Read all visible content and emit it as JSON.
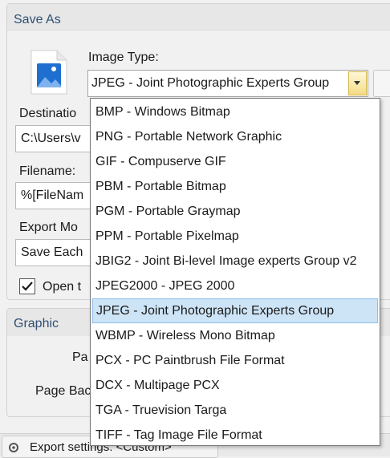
{
  "save_as": {
    "title": "Save As",
    "image_type_label": "Image Type:",
    "image_type_value": "JPEG - Joint Photographic Experts Group",
    "destination_label": "Destinatio",
    "destination_value": "C:\\Users\\v",
    "filename_label": "Filename:",
    "filename_value": "%[FileNam",
    "export_mode_label": "Export Mo",
    "export_mode_value": "Save Each",
    "open_label": "Open t",
    "open_checked": true
  },
  "graphic": {
    "title": "Graphic",
    "pa_label": "Pa",
    "page_bac_label": "Page Bac"
  },
  "footer": {
    "export_settings": "Export settings:  <Custom>"
  },
  "dropdown": {
    "options": [
      "BMP - Windows Bitmap",
      "PNG - Portable Network Graphic",
      "GIF - Compuserve GIF",
      "PBM - Portable Bitmap",
      "PGM - Portable Graymap",
      "PPM - Portable Pixelmap",
      "JBIG2 - Joint Bi-level Image experts Group v2",
      "JPEG2000 - JPEG 2000",
      "JPEG - Joint Photographic Experts Group",
      "WBMP - Wireless Mono Bitmap",
      "PCX - PC Paintbrush File Format",
      "DCX - Multipage PCX",
      "TGA - Truevision Targa",
      "TIFF - Tag Image File Format"
    ],
    "selected_index": 8
  },
  "colors": {
    "group_title": "#2f4f73",
    "selection_bg": "#cde4f7",
    "selection_border": "#8fbde6",
    "combo_button": "#f3dc86",
    "icon_blue": "#1f6fd1"
  }
}
